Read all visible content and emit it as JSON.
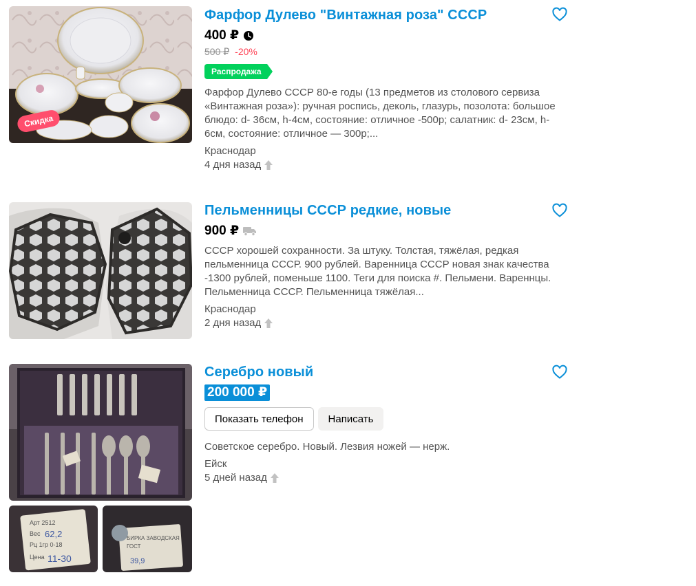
{
  "listings": [
    {
      "title": "Фарфор Дулево \"Винтажная роза\" СССР",
      "price": "400 ₽",
      "price_icon": "clock-icon",
      "old_price": "500 ₽",
      "discount": "-20%",
      "sale_badge": "Распродажа",
      "photo_badge": "Скидка",
      "description": "Фарфор Дулево СССР 80-е годы (13 предметов из столового сервиза «Винтажная роза»): ручная роспись, деколь, глазурь, позолота: большое блюдо: d- 36см, h-4см, состояние: отличное -500р; салатник: d- 23см, h-6см, состояние: отличное — 300р;...",
      "location": "Краснодар",
      "date": "4 дня назад",
      "favorite_icon": "heart-icon"
    },
    {
      "title": "Пельменницы СССР редкие, новые",
      "price": "900 ₽",
      "price_icon": "delivery-truck-icon",
      "description": "СССР хорошей сохранности. За штуку. Толстая, тяжёлая, редкая пельменница СССР. 900 рублей. Варенница СССР новая знак качества -1300 рублей, поменьше 1100. Теги для поиска #. Пельмени. Вареннцы. Пельменница СССР. Пельменница тяжёлая...",
      "location": "Краснодар",
      "date": "2 дня назад",
      "favorite_icon": "heart-icon"
    },
    {
      "title": "Серебро новый",
      "price": "200 000 ₽",
      "show_phone_label": "Показать телефон",
      "write_label": "Написать",
      "description": "Советское серебро. Новый. Лезвия ножей — нерж.",
      "location": "Ейск",
      "date": "5 дней назад",
      "favorite_icon": "heart-icon"
    }
  ],
  "colors": {
    "title": "#0a8fd8",
    "sale": "#02d15c",
    "discount": "#ff4053",
    "photo_badge": "#ff4e6d"
  }
}
